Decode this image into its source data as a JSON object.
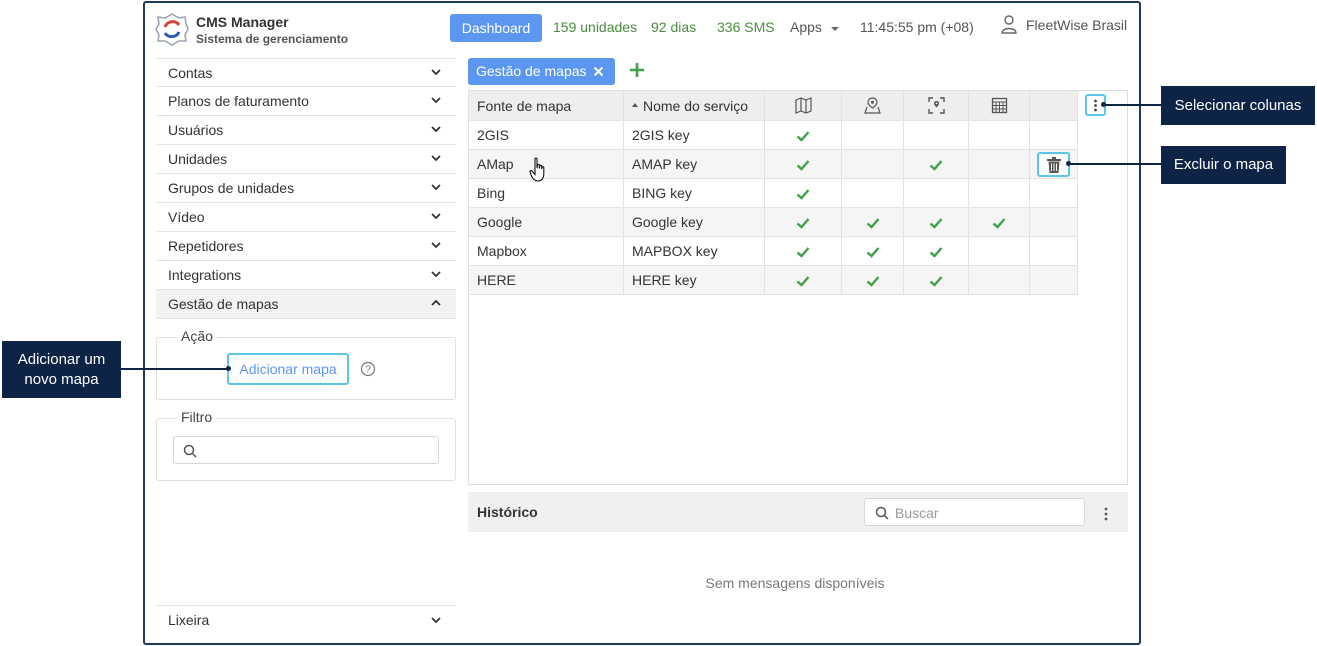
{
  "header": {
    "app_title": "CMS Manager",
    "app_subtitle": "Sistema de gerenciamento",
    "dashboard_label": "Dashboard",
    "units": "159 unidades",
    "days": "92 dias",
    "sms": "336 SMS",
    "apps_label": "Apps",
    "clock": "11:45:55 pm (+08)",
    "user_name": "FleetWise Brasil"
  },
  "sidebar": {
    "items": [
      {
        "label": "Contas"
      },
      {
        "label": "Planos de faturamento"
      },
      {
        "label": "Usuários"
      },
      {
        "label": "Unidades"
      },
      {
        "label": "Grupos de unidades"
      },
      {
        "label": "Vídeo"
      },
      {
        "label": "Repetidores"
      },
      {
        "label": "Integrations"
      },
      {
        "label": "Gestão de mapas"
      }
    ],
    "action_legend": "Ação",
    "add_map_label": "Adicionar mapa",
    "filter_legend": "Filtro",
    "trash_label": "Lixeira"
  },
  "tab": {
    "label": "Gestão de mapas"
  },
  "grid": {
    "columns": {
      "source": "Fonte de mapa",
      "service": "Nome do serviço"
    },
    "rows": [
      {
        "source": "2GIS",
        "service": "2GIS key",
        "checks": [
          true,
          false,
          false,
          false
        ]
      },
      {
        "source": "AMap",
        "service": "AMAP key",
        "checks": [
          true,
          false,
          true,
          false
        ]
      },
      {
        "source": "Bing",
        "service": "BING key",
        "checks": [
          true,
          false,
          false,
          false
        ]
      },
      {
        "source": "Google",
        "service": "Google key",
        "checks": [
          true,
          true,
          true,
          true
        ]
      },
      {
        "source": "Mapbox",
        "service": "MAPBOX key",
        "checks": [
          true,
          true,
          true,
          false
        ]
      },
      {
        "source": "HERE",
        "service": "HERE key",
        "checks": [
          true,
          true,
          true,
          false
        ]
      }
    ]
  },
  "history": {
    "title": "Histórico",
    "search_placeholder": "Buscar",
    "empty_message": "Sem mensagens disponíveis"
  },
  "callouts": {
    "add_map": "Adicionar um novo mapa",
    "select_columns": "Selecionar colunas",
    "delete_map": "Excluir o mapa"
  },
  "colors": {
    "accent": "#5b97f0",
    "highlight": "#5bc6e5",
    "green": "#4a8c3f",
    "callout": "#0d2447",
    "check": "#3fa14a"
  }
}
